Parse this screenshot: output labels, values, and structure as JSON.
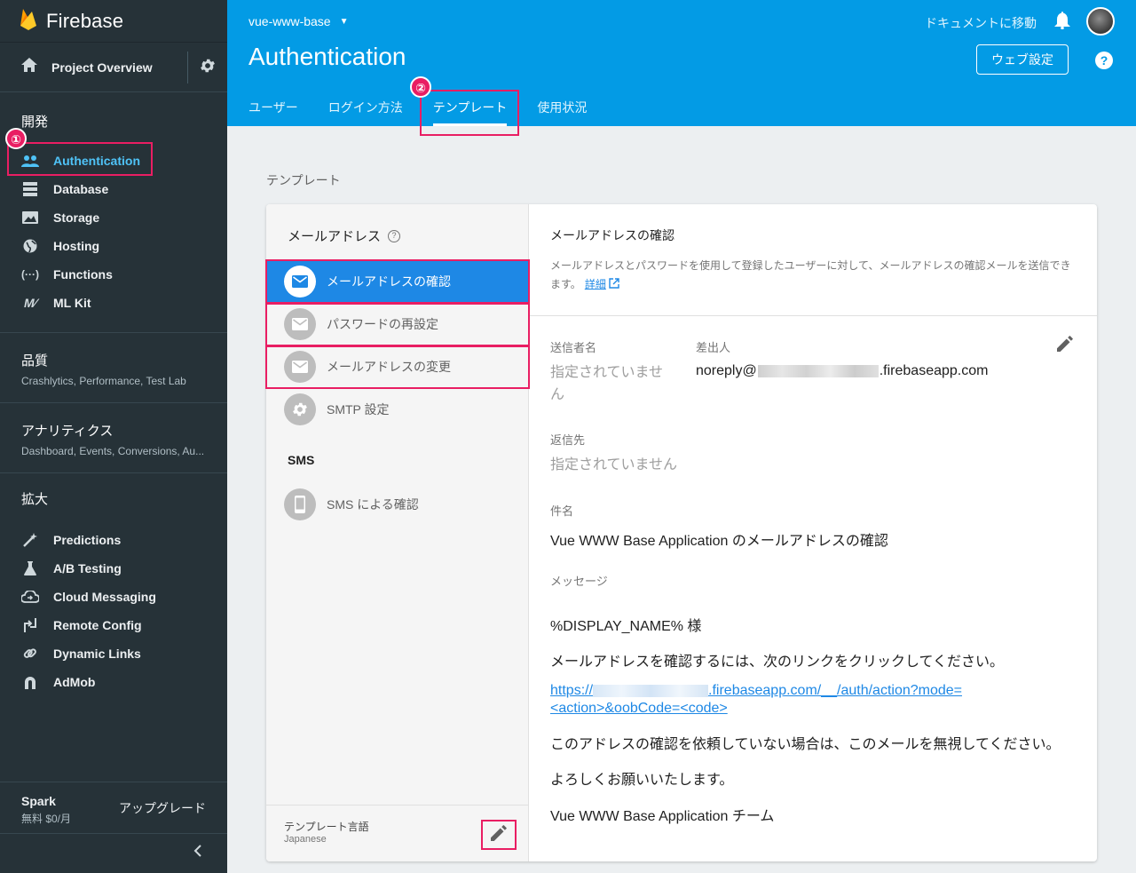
{
  "sidebar": {
    "brand": "Firebase",
    "overview_label": "Project Overview",
    "sections": [
      {
        "title": "開発",
        "items": [
          {
            "label": "Authentication",
            "icon": "people-icon",
            "active": true
          },
          {
            "label": "Database",
            "icon": "database-icon"
          },
          {
            "label": "Storage",
            "icon": "image-icon"
          },
          {
            "label": "Hosting",
            "icon": "globe-icon"
          },
          {
            "label": "Functions",
            "icon": "functions-icon"
          },
          {
            "label": "ML Kit",
            "icon": "ml-icon"
          }
        ]
      },
      {
        "title": "品質",
        "subtitle": "Crashlytics, Performance, Test Lab"
      },
      {
        "title": "アナリティクス",
        "subtitle": "Dashboard, Events, Conversions, Au..."
      },
      {
        "title": "拡大",
        "items": [
          {
            "label": "Predictions",
            "icon": "wand-icon"
          },
          {
            "label": "A/B Testing",
            "icon": "flask-icon"
          },
          {
            "label": "Cloud Messaging",
            "icon": "cloud-icon"
          },
          {
            "label": "Remote Config",
            "icon": "remote-config-icon"
          },
          {
            "label": "Dynamic Links",
            "icon": "link-icon"
          },
          {
            "label": "AdMob",
            "icon": "admob-icon"
          }
        ]
      }
    ],
    "plan": {
      "name": "Spark",
      "price": "無料 $0/月",
      "upgrade": "アップグレード"
    },
    "collapse_icon": "chevron-left-icon"
  },
  "header": {
    "project": "vue-www-base",
    "docs_link": "ドキュメントに移動",
    "title": "Authentication",
    "web_setup": "ウェブ設定",
    "help": "?",
    "tabs": [
      {
        "label": "ユーザー"
      },
      {
        "label": "ログイン方法"
      },
      {
        "label": "テンプレート",
        "active": true
      },
      {
        "label": "使用状況"
      }
    ]
  },
  "content": {
    "section_label": "テンプレート",
    "left": {
      "email_heading": "メールアドレス",
      "items": [
        {
          "label": "メールアドレスの確認",
          "icon": "mail-icon",
          "selected": true
        },
        {
          "label": "パスワードの再設定",
          "icon": "mail-icon"
        },
        {
          "label": "メールアドレスの変更",
          "icon": "mail-icon"
        },
        {
          "label": "SMTP 設定",
          "icon": "gear-icon"
        }
      ],
      "sms_heading": "SMS",
      "sms_item": {
        "label": "SMS による確認",
        "icon": "phone-icon"
      },
      "language_title": "テンプレート言語",
      "language_value": "Japanese"
    },
    "right": {
      "title": "メールアドレスの確認",
      "description": "メールアドレスとパスワードを使用して登録したユーザーに対して、メールアドレスの確認メールを送信できます。",
      "details_link": "詳細",
      "sender_name_label": "送信者名",
      "sender_name_value": "指定されていません",
      "from_label": "差出人",
      "from_prefix": "noreply@",
      "from_suffix": ".firebaseapp.com",
      "reply_to_label": "返信先",
      "reply_to_value": "指定されていません",
      "subject_label": "件名",
      "subject_value": "Vue WWW Base Application のメールアドレスの確認",
      "message_label": "メッセージ",
      "message_lines": [
        "%DISPLAY_NAME% 様",
        "メールアドレスを確認するには、次のリンクをクリックしてください。",
        "このアドレスの確認を依頼していない場合は、このメールを無視してください。",
        "よろしくお願いいたします。",
        "Vue WWW Base Application チーム"
      ],
      "link_prefix": "https://",
      "link_suffix": ".firebaseapp.com/__/auth/action?mode=<action>&oobCode=<code>"
    }
  },
  "annotations": {
    "badge1": "①",
    "badge2": "②"
  },
  "colors": {
    "sidebar": "#263238",
    "header": "#039be5",
    "selected": "#1e88e5",
    "highlight": "#e91e63"
  }
}
